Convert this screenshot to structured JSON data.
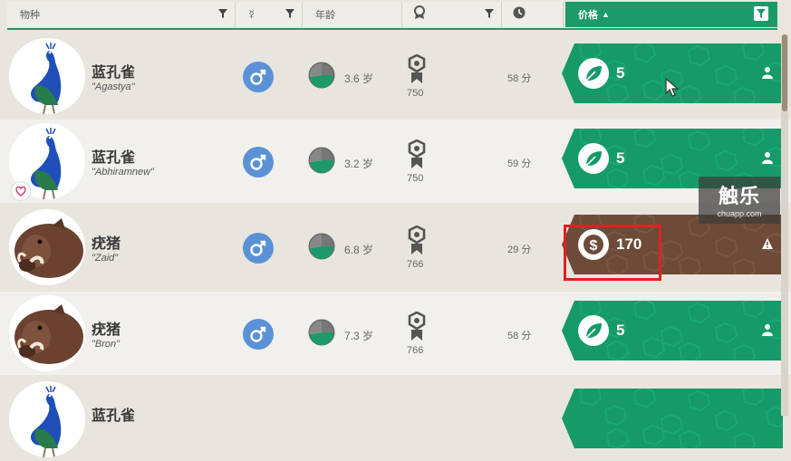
{
  "header": {
    "species": "物种",
    "sex_icon": "mercury-icon",
    "age": "年龄",
    "award_icon": "award-icon",
    "time_icon": "clock-icon",
    "price": "价格",
    "sort": "▲"
  },
  "rows": [
    {
      "name": "蓝孔雀",
      "nick": "\"Agastya\"",
      "animal": "peacock",
      "sex": "male",
      "age": "3.6 岁",
      "award": "750",
      "time": "58 分",
      "currency": "leaf",
      "price": "5",
      "right_icon": "person-icon",
      "favorite": false
    },
    {
      "name": "蓝孔雀",
      "nick": "\"Abhiramnew\"",
      "animal": "peacock",
      "sex": "male",
      "age": "3.2 岁",
      "award": "750",
      "time": "59 分",
      "currency": "leaf",
      "price": "5",
      "right_icon": "person-icon",
      "favorite": true
    },
    {
      "name": "疣猪",
      "nick": "\"Zaid\"",
      "animal": "warthog",
      "sex": "male",
      "age": "6.8 岁",
      "award": "766",
      "time": "29 分",
      "currency": "dollar",
      "price": "170",
      "right_icon": "warning-icon",
      "favorite": false
    },
    {
      "name": "疣猪",
      "nick": "\"Bron\"",
      "animal": "warthog",
      "sex": "male",
      "age": "7.3 岁",
      "award": "766",
      "time": "58 分",
      "currency": "leaf",
      "price": "5",
      "right_icon": "person-icon",
      "favorite": false
    },
    {
      "name": "蓝孔雀",
      "nick": "",
      "animal": "peacock",
      "sex": "male",
      "age": "",
      "award": "",
      "time": "",
      "currency": "leaf",
      "price": "",
      "right_icon": "",
      "favorite": false
    }
  ],
  "watermark": {
    "big": "触乐",
    "small": "chuapp.com"
  },
  "colors": {
    "green": "#159a68",
    "brown": "#6d4b38",
    "male": "#5b92d6",
    "highlight": "#e02020"
  }
}
